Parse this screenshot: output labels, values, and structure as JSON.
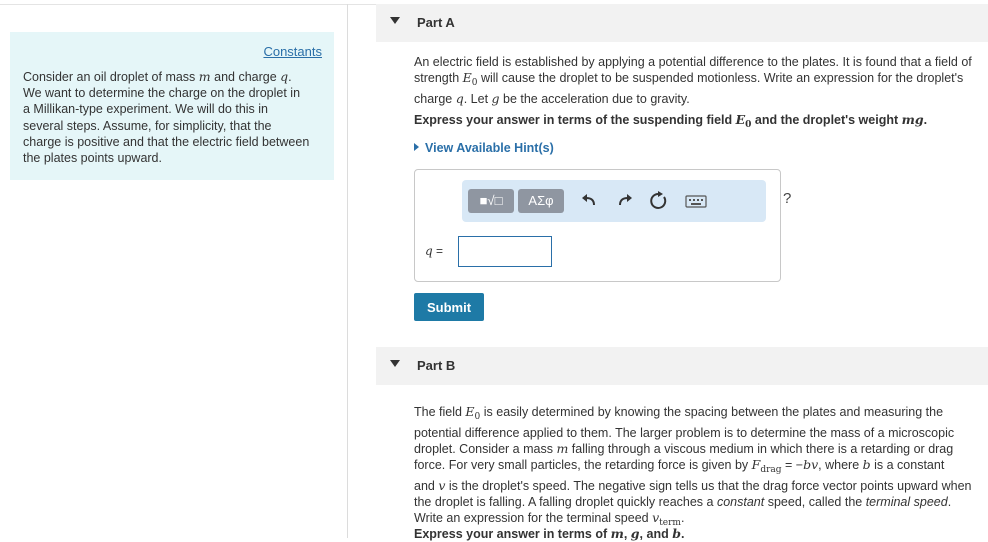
{
  "sidebar": {
    "constants_link": "Constants",
    "intro_lines": [
      [
        "Consider an oil droplet of mass ",
        "m",
        " and charge ",
        "q",
        "."
      ],
      [
        "We want to determine the charge on the droplet in"
      ],
      [
        "a Millikan-type experiment. We will do this in"
      ],
      [
        "several steps. Assume, for simplicity, that the"
      ],
      [
        "charge is positive and that the electric field between"
      ],
      [
        "the plates points upward."
      ]
    ]
  },
  "partA": {
    "title": "Part A",
    "q_line1": "An electric field is established by applying a potential difference to the plates. It is found that a field of",
    "q_line2_a": "strength ",
    "q_line2_var": "E",
    "q_line2_sub": "0",
    "q_line2_b": " will cause the droplet to be suspended motionless. Write an expression for the droplet's",
    "q_line3_a": "charge ",
    "q_line3_var": "q",
    "q_line3_b": ". Let ",
    "q_line3_var2": "g",
    "q_line3_c": " be the acceleration due to gravity.",
    "instr_a": "Express your answer in terms of the suspending field ",
    "instr_var": "E",
    "instr_sub": "0",
    "instr_b": " and the droplet's weight ",
    "instr_var2": "mg",
    "instr_c": ".",
    "hint_link": "View Available Hint(s)",
    "toolbar": {
      "template_label": "■√□",
      "symbols_label": "ΑΣφ",
      "help_label": "?"
    },
    "answer_label_var": "q",
    "answer_label_eq": " =",
    "answer_value": "",
    "submit_label": "Submit"
  },
  "partB": {
    "title": "Part B",
    "line1_a": "The field ",
    "line1_var": "E",
    "line1_sub": "0",
    "line1_b": " is easily determined by knowing the spacing between the plates and measuring the",
    "line2": "potential difference applied to them. The larger problem is to determine the mass of a microscopic",
    "line3_a": "droplet. Consider a mass ",
    "line3_var": "m",
    "line3_b": " falling through a viscous medium in which there is a retarding or drag",
    "line4_a": "force. For very small particles, the retarding force is given by ",
    "line4_var": "F",
    "line4_sub": "drag",
    "line4_b": " = −",
    "line4_var2": "bv",
    "line4_c": ", where ",
    "line4_var3": "b",
    "line4_d": " is a constant",
    "line5_a": "and ",
    "line5_var": "v",
    "line5_b": " is the droplet's speed. The negative sign tells us that the drag force vector points upward when",
    "line6_a": "the droplet is falling. A falling droplet quickly reaches a ",
    "line6_em": "constant",
    "line6_b": " speed, called the ",
    "line6_em2": "terminal speed",
    "line6_c": ".",
    "line7_a": "Write an expression for the terminal speed ",
    "line7_var": "v",
    "line7_sub": "term",
    "line7_b": ".",
    "instr_a": "Express your answer in terms of ",
    "instr_v1": "m",
    "instr_b": ", ",
    "instr_v2": "g",
    "instr_c": ", and ",
    "instr_v3": "b",
    "instr_d": "."
  }
}
